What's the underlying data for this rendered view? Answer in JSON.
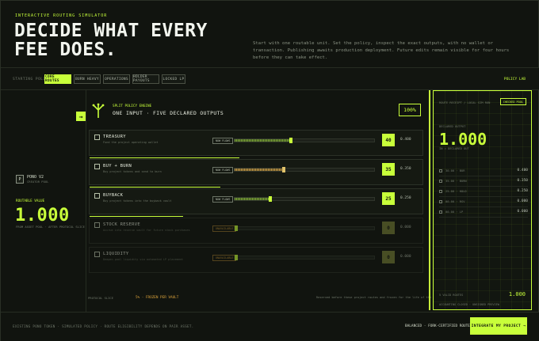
{
  "header": {
    "eyebrow": "INTERACTIVE ROUTING SIMULATOR",
    "hero_line1": "DECIDE WHAT EVERY",
    "hero_line2": "FEE DOES.",
    "description": "Start with one routable unit. Set the policy, inspect the exact outputs, with no wallet or transaction. Publishing awaits production deployment. Future edits remain visible for four hours before they can take effect."
  },
  "policy": {
    "label": "STARTING POLICY",
    "tabs": [
      {
        "label": "CORE ROUTES",
        "active": true
      },
      {
        "label": "BURN HEAVY",
        "active": false
      },
      {
        "label": "OPERATIONS",
        "active": false
      },
      {
        "label": "HOLDER PAYOUTS",
        "active": false
      },
      {
        "label": "LOCKED LP",
        "active": false
      }
    ],
    "lab_label": "POLICY LAB"
  },
  "source": {
    "token_glyph": "P",
    "token_name": "PONO V2",
    "token_sub": "CREATOR POOL",
    "routable_label": "ROUTABLE VALUE",
    "routable_value": "1.000",
    "routable_sub": "FROM ASSET POOL · AFTER PROTOCOL SLICE",
    "arrow": "→"
  },
  "engine": {
    "kicker": "SPLIT POLICY ENGINE",
    "title": "ONE INPUT · FIVE DECLARED OUTPUTS",
    "total": "100%",
    "rows": [
      {
        "name": "TREASURY",
        "desc": "Fund the project operating wallet",
        "tag": "NOW FLOWS",
        "percent": 40,
        "value": "0.400",
        "fill": 0.4,
        "style": "normal",
        "dim": false
      },
      {
        "name": "BUY + BURN",
        "desc": "Buy project tokens and send to burn",
        "tag": "NOW FLOWS",
        "percent": 35,
        "value": "0.350",
        "fill": 0.35,
        "style": "burn",
        "dim": false
      },
      {
        "name": "BUYBACK",
        "desc": "Buy project tokens into the buyback vault",
        "tag": "NOW FLOWS",
        "percent": 25,
        "value": "0.250",
        "fill": 0.25,
        "style": "normal",
        "dim": false
      },
      {
        "name": "STOCK RESERVE",
        "desc": "Accrue into reserve vault for future stock purchases",
        "tag": "UNAVAILABLE",
        "percent": 0,
        "value": "0.000",
        "fill": 0,
        "style": "normal",
        "dim": true
      },
      {
        "name": "LIQUIDITY",
        "desc": "Deepen pool liquidity via automated LP placement",
        "tag": "UNAVAILABLE",
        "percent": 0,
        "value": "0.000",
        "fill": 0,
        "style": "normal",
        "dim": true
      }
    ],
    "foot_label": "PROTOCOL SLICE",
    "foot_frozen": "5% · FROZEN PER VAULT",
    "foot_note": "Reserved before these project routes and frozen for the life of the vault."
  },
  "receipt": {
    "kicker": "ROUTE RECEIPT / LOCAL SIM RUN",
    "button": "CHECKED POOL",
    "label": "DECLARED OUTPUT",
    "value": "1.000",
    "sub": "IN = DECLARED OUT",
    "items": [
      {
        "key": "30.00 · BUR",
        "value": "0.400"
      },
      {
        "key": "35.00 · BURN",
        "value": "0.350"
      },
      {
        "key": "25.00 · HOLD",
        "value": "0.250"
      },
      {
        "key": "00.00 · RSV",
        "value": "0.000"
      },
      {
        "key": "00.00 · LP",
        "value": "0.000"
      }
    ],
    "total_label": "5 VALID ROUTES",
    "total_value": "1.000",
    "foot": "ACCOUNTING CLOSED · UNSIGNED PREVIEW"
  },
  "footer": {
    "text": "EXISTING PONO TOKEN · SIMULATED POLICY · ROUTE ELIGIBILITY DEPENDS ON PAIR ASSET.",
    "status_a": "BALANCED",
    "status_b": " · FORK-CERTIFIED ROUTES",
    "cta": "INTEGRATE MY PROJECT →"
  },
  "colors": {
    "accent": "#c8ff3a",
    "warn": "#d9a23a",
    "bg": "#11140f"
  }
}
